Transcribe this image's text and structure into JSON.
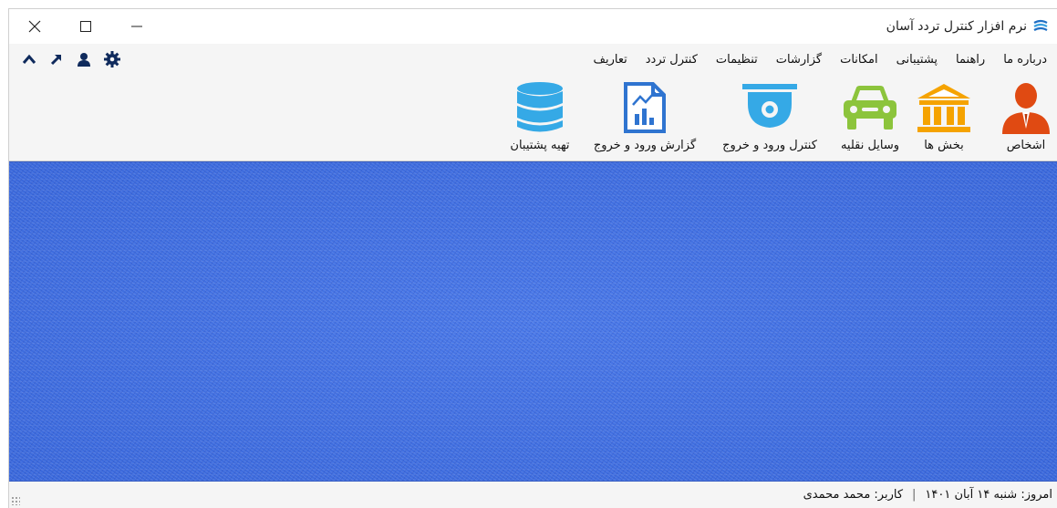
{
  "window": {
    "title": "نرم افزار کنترل تردد آسان",
    "icon": "app-logo-icon",
    "controls": [
      "close-icon",
      "maximize-icon",
      "minimize-icon"
    ]
  },
  "menu": {
    "items": [
      {
        "label": "تعاریف"
      },
      {
        "label": "کنترل تردد"
      },
      {
        "label": "تنظیمات"
      },
      {
        "label": "گزارشات"
      },
      {
        "label": "امکانات"
      },
      {
        "label": "پشتیبانی"
      },
      {
        "label": "راهنما"
      },
      {
        "label": "درباره ما"
      }
    ],
    "quick_tools": [
      "chevron-up-icon",
      "arrow-up-right-icon",
      "user-icon",
      "gear-icon"
    ]
  },
  "toolbar": {
    "items": [
      {
        "label": "اشخاص",
        "icon": "person-icon"
      },
      {
        "label": "بخش ها",
        "icon": "building-icon"
      },
      {
        "label": "وسایل نقلیه",
        "icon": "car-icon"
      },
      {
        "label": "کنترل ورود و خروج",
        "icon": "security-camera-icon"
      },
      {
        "label": "گزارش ورود و خروج",
        "icon": "report-chart-icon"
      },
      {
        "label": "تهیه پشتیبان",
        "icon": "database-icon"
      }
    ]
  },
  "colors": {
    "content_background": "#3d6ee0",
    "person_icon": "#e04a12",
    "building_icon": "#f5a300",
    "car_icon": "#8cc43c",
    "camera_icon": "#35a9e6",
    "report_icon": "#2f74d0",
    "database_icon": "#35a9e6",
    "quick_tools": "#0f2a5c"
  },
  "status": {
    "date": "امروز: شنبه ۱۴ آبان ۱۴۰۱",
    "separator": "|",
    "user": "کاربر: محمد محمدی"
  }
}
